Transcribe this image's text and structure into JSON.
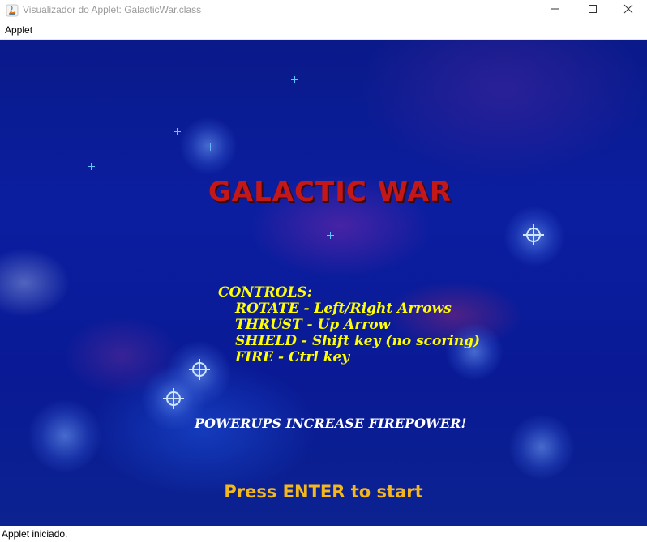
{
  "window": {
    "title": "Visualizador do Applet: GalacticWar.class",
    "app_icon": "java-icon",
    "minimize_glyph": "—",
    "maximize_glyph": "☐",
    "close_glyph": "✕"
  },
  "menu": {
    "items": [
      "Applet"
    ]
  },
  "game": {
    "title": "GALACTIC WAR",
    "controls_header": "CONTROLS:",
    "controls": [
      "ROTATE - Left/Right Arrows",
      "THRUST - Up Arrow",
      "SHIELD - Shift key (no scoring)",
      "FIRE - Ctrl key"
    ],
    "powerups": "POWERUPS INCREASE FIREPOWER!",
    "prompt": "Press ENTER to start",
    "colors": {
      "background": "#0b1ea0",
      "title": "#c41818",
      "controls": "#ffff00",
      "powerups": "#ffffff",
      "prompt": "#f5b81c",
      "stars": "#5cc8ff"
    }
  },
  "status": {
    "text": "Applet iniciado."
  }
}
